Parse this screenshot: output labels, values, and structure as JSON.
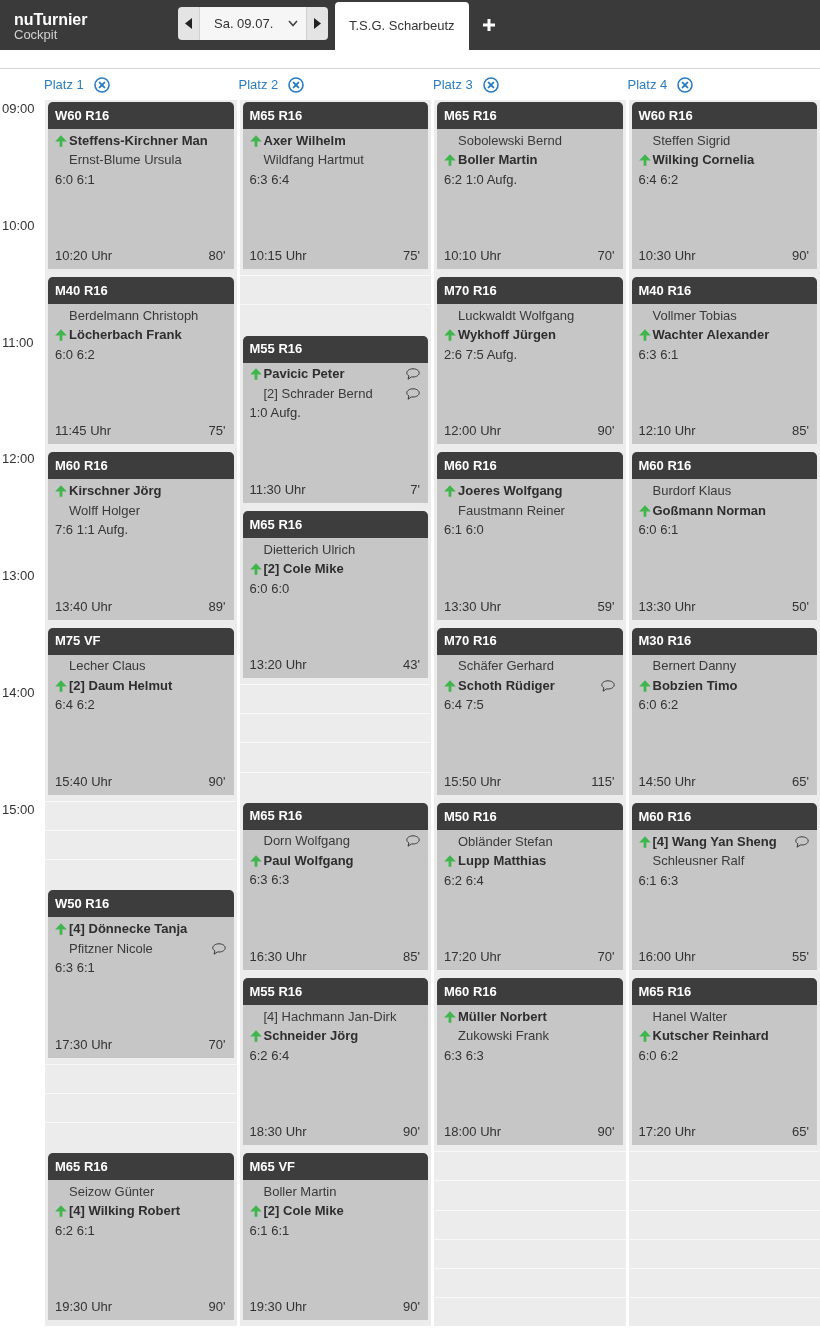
{
  "header": {
    "logo": {
      "title": "nuTurnier",
      "subtitle": "Cockpit"
    },
    "date_nav": {
      "value": "Sa. 09.07."
    },
    "tabs": [
      {
        "label": "T.S.G. Scharbeutz",
        "selected": true
      }
    ]
  },
  "time_labels": [
    "09:00",
    "10:00",
    "11:00",
    "12:00",
    "13:00",
    "14:00",
    "15:00"
  ],
  "courts": [
    {
      "label": "Platz 1",
      "entries": [
        {
          "kind": "match",
          "category": "W60 R16",
          "players": [
            {
              "name": "Steffens-Kirchner Man",
              "winner": true,
              "note": false
            },
            {
              "name": "Ernst-Blume Ursula",
              "winner": false,
              "note": false
            }
          ],
          "score": "6:0 6:1",
          "end_time": "10:20 Uhr",
          "duration": "80'"
        },
        {
          "kind": "match",
          "category": "M40 R16",
          "players": [
            {
              "name": "Berdelmann Christoph",
              "winner": false,
              "note": false
            },
            {
              "name": "Löcherbach Frank",
              "winner": true,
              "note": false
            }
          ],
          "score": "6:0 6:2",
          "end_time": "11:45 Uhr",
          "duration": "75'"
        },
        {
          "kind": "match",
          "category": "M60 R16",
          "players": [
            {
              "name": "Kirschner Jörg",
              "winner": true,
              "note": false
            },
            {
              "name": "Wolff Holger",
              "winner": false,
              "note": false
            }
          ],
          "score": "7:6 1:1 Aufg.",
          "end_time": "13:40 Uhr",
          "duration": "89'"
        },
        {
          "kind": "match",
          "category": "M75 VF",
          "players": [
            {
              "name": "Lecher Claus",
              "winner": false,
              "note": false
            },
            {
              "name": "[2] Daum Helmut",
              "winner": true,
              "note": false
            }
          ],
          "score": "6:4 6:2",
          "end_time": "15:40 Uhr",
          "duration": "90'"
        },
        {
          "kind": "free"
        },
        {
          "kind": "free"
        },
        {
          "kind": "free"
        },
        {
          "kind": "match",
          "category": "W50 R16",
          "players": [
            {
              "name": "[4] Dönnecke Tanja",
              "winner": true,
              "note": false
            },
            {
              "name": "Pfitzner Nicole",
              "winner": false,
              "note": true
            }
          ],
          "score": "6:3 6:1",
          "end_time": "17:30 Uhr",
          "duration": "70'"
        },
        {
          "kind": "free"
        },
        {
          "kind": "free"
        },
        {
          "kind": "free"
        },
        {
          "kind": "match",
          "category": "M65 R16",
          "players": [
            {
              "name": "Seizow Günter",
              "winner": false,
              "note": false
            },
            {
              "name": "[4] Wilking Robert",
              "winner": true,
              "note": false
            }
          ],
          "score": "6:2 6:1",
          "end_time": "19:30 Uhr",
          "duration": "90'"
        }
      ]
    },
    {
      "label": "Platz 2",
      "entries": [
        {
          "kind": "match",
          "category": "M65 R16",
          "players": [
            {
              "name": "Axer Wilhelm",
              "winner": true,
              "note": false
            },
            {
              "name": "Wildfang Hartmut",
              "winner": false,
              "note": false
            }
          ],
          "score": "6:3 6:4",
          "end_time": "10:15 Uhr",
          "duration": "75'"
        },
        {
          "kind": "free"
        },
        {
          "kind": "free"
        },
        {
          "kind": "match",
          "category": "M55 R16",
          "players": [
            {
              "name": "Pavicic Peter",
              "winner": true,
              "note": true
            },
            {
              "name": "[2] Schrader Bernd",
              "winner": false,
              "note": true
            }
          ],
          "score": "1:0 Aufg.",
          "end_time": "11:30 Uhr",
          "duration": "7'"
        },
        {
          "kind": "match",
          "category": "M65 R16",
          "players": [
            {
              "name": "Dietterich Ulrich",
              "winner": false,
              "note": false
            },
            {
              "name": "[2] Cole Mike",
              "winner": true,
              "note": false
            }
          ],
          "score": "6:0 6:0",
          "end_time": "13:20 Uhr",
          "duration": "43'"
        },
        {
          "kind": "free"
        },
        {
          "kind": "free"
        },
        {
          "kind": "free"
        },
        {
          "kind": "free"
        },
        {
          "kind": "match",
          "category": "M65 R16",
          "players": [
            {
              "name": "Dorn Wolfgang",
              "winner": false,
              "note": true
            },
            {
              "name": "Paul Wolfgang",
              "winner": true,
              "note": false
            }
          ],
          "score": "6:3 6:3",
          "end_time": "16:30 Uhr",
          "duration": "85'"
        },
        {
          "kind": "match",
          "category": "M55 R16",
          "players": [
            {
              "name": "[4] Hachmann Jan-Dirk",
              "winner": false,
              "note": false
            },
            {
              "name": "Schneider Jörg",
              "winner": true,
              "note": false
            }
          ],
          "score": "6:2 6:4",
          "end_time": "18:30 Uhr",
          "duration": "90'"
        },
        {
          "kind": "match",
          "category": "M65 VF",
          "players": [
            {
              "name": "Boller Martin",
              "winner": false,
              "note": false
            },
            {
              "name": "[2] Cole Mike",
              "winner": true,
              "note": false
            }
          ],
          "score": "6:1 6:1",
          "end_time": "19:30 Uhr",
          "duration": "90'"
        }
      ]
    },
    {
      "label": "Platz 3",
      "entries": [
        {
          "kind": "match",
          "category": "M65 R16",
          "players": [
            {
              "name": "Sobolewski Bernd",
              "winner": false,
              "note": false
            },
            {
              "name": "Boller Martin",
              "winner": true,
              "note": false
            }
          ],
          "score": "6:2 1:0 Aufg.",
          "end_time": "10:10 Uhr",
          "duration": "70'"
        },
        {
          "kind": "match",
          "category": "M70 R16",
          "players": [
            {
              "name": "Luckwaldt Wolfgang",
              "winner": false,
              "note": false
            },
            {
              "name": "Wykhoff Jürgen",
              "winner": true,
              "note": false
            }
          ],
          "score": "2:6 7:5 Aufg.",
          "end_time": "12:00 Uhr",
          "duration": "90'"
        },
        {
          "kind": "match",
          "category": "M60 R16",
          "players": [
            {
              "name": "Joeres Wolfgang",
              "winner": true,
              "note": false
            },
            {
              "name": "Faustmann Reiner",
              "winner": false,
              "note": false
            }
          ],
          "score": "6:1 6:0",
          "end_time": "13:30 Uhr",
          "duration": "59'"
        },
        {
          "kind": "match",
          "category": "M70 R16",
          "players": [
            {
              "name": "Schäfer Gerhard",
              "winner": false,
              "note": false
            },
            {
              "name": "Schoth Rüdiger",
              "winner": true,
              "note": true
            }
          ],
          "score": "6:4 7:5",
          "end_time": "15:50 Uhr",
          "duration": "115'"
        },
        {
          "kind": "match",
          "category": "M50 R16",
          "players": [
            {
              "name": "Obländer Stefan",
              "winner": false,
              "note": false
            },
            {
              "name": "Lupp Matthias",
              "winner": true,
              "note": false
            }
          ],
          "score": "6:2 6:4",
          "end_time": "17:20 Uhr",
          "duration": "70'"
        },
        {
          "kind": "match",
          "category": "M60 R16",
          "players": [
            {
              "name": "Müller Norbert",
              "winner": true,
              "note": false
            },
            {
              "name": "Zukowski Frank",
              "winner": false,
              "note": false
            }
          ],
          "score": "6:3 6:3",
          "end_time": "18:00 Uhr",
          "duration": "90'"
        },
        {
          "kind": "free"
        },
        {
          "kind": "free"
        },
        {
          "kind": "free"
        },
        {
          "kind": "free"
        },
        {
          "kind": "free"
        },
        {
          "kind": "free"
        }
      ]
    },
    {
      "label": "Platz 4",
      "entries": [
        {
          "kind": "match",
          "category": "W60 R16",
          "players": [
            {
              "name": "Steffen Sigrid",
              "winner": false,
              "note": false
            },
            {
              "name": "Wilking Cornelia",
              "winner": true,
              "note": false
            }
          ],
          "score": "6:4 6:2",
          "end_time": "10:30 Uhr",
          "duration": "90'"
        },
        {
          "kind": "match",
          "category": "M40 R16",
          "players": [
            {
              "name": "Vollmer Tobias",
              "winner": false,
              "note": false
            },
            {
              "name": "Wachter Alexander",
              "winner": true,
              "note": false
            }
          ],
          "score": "6:3 6:1",
          "end_time": "12:10 Uhr",
          "duration": "85'"
        },
        {
          "kind": "match",
          "category": "M60 R16",
          "players": [
            {
              "name": "Burdorf Klaus",
              "winner": false,
              "note": false
            },
            {
              "name": "Goßmann Norman",
              "winner": true,
              "note": false
            }
          ],
          "score": "6:0 6:1",
          "end_time": "13:30 Uhr",
          "duration": "50'"
        },
        {
          "kind": "match",
          "category": "M30 R16",
          "players": [
            {
              "name": "Bernert Danny",
              "winner": false,
              "note": false
            },
            {
              "name": "Bobzien Timo",
              "winner": true,
              "note": false
            }
          ],
          "score": "6:0 6:2",
          "end_time": "14:50 Uhr",
          "duration": "65'"
        },
        {
          "kind": "match",
          "category": "M60 R16",
          "players": [
            {
              "name": "[4] Wang Yan Sheng",
              "winner": true,
              "note": true
            },
            {
              "name": "Schleusner Ralf",
              "winner": false,
              "note": false
            }
          ],
          "score": "6:1 6:3",
          "end_time": "16:00 Uhr",
          "duration": "55'"
        },
        {
          "kind": "match",
          "category": "M65 R16",
          "players": [
            {
              "name": "Hanel Walter",
              "winner": false,
              "note": false
            },
            {
              "name": "Kutscher Reinhard",
              "winner": true,
              "note": false
            }
          ],
          "score": "6:0 6:2",
          "end_time": "17:20 Uhr",
          "duration": "65'"
        },
        {
          "kind": "free"
        },
        {
          "kind": "free"
        },
        {
          "kind": "free"
        },
        {
          "kind": "free"
        },
        {
          "kind": "free"
        },
        {
          "kind": "free"
        }
      ]
    }
  ]
}
